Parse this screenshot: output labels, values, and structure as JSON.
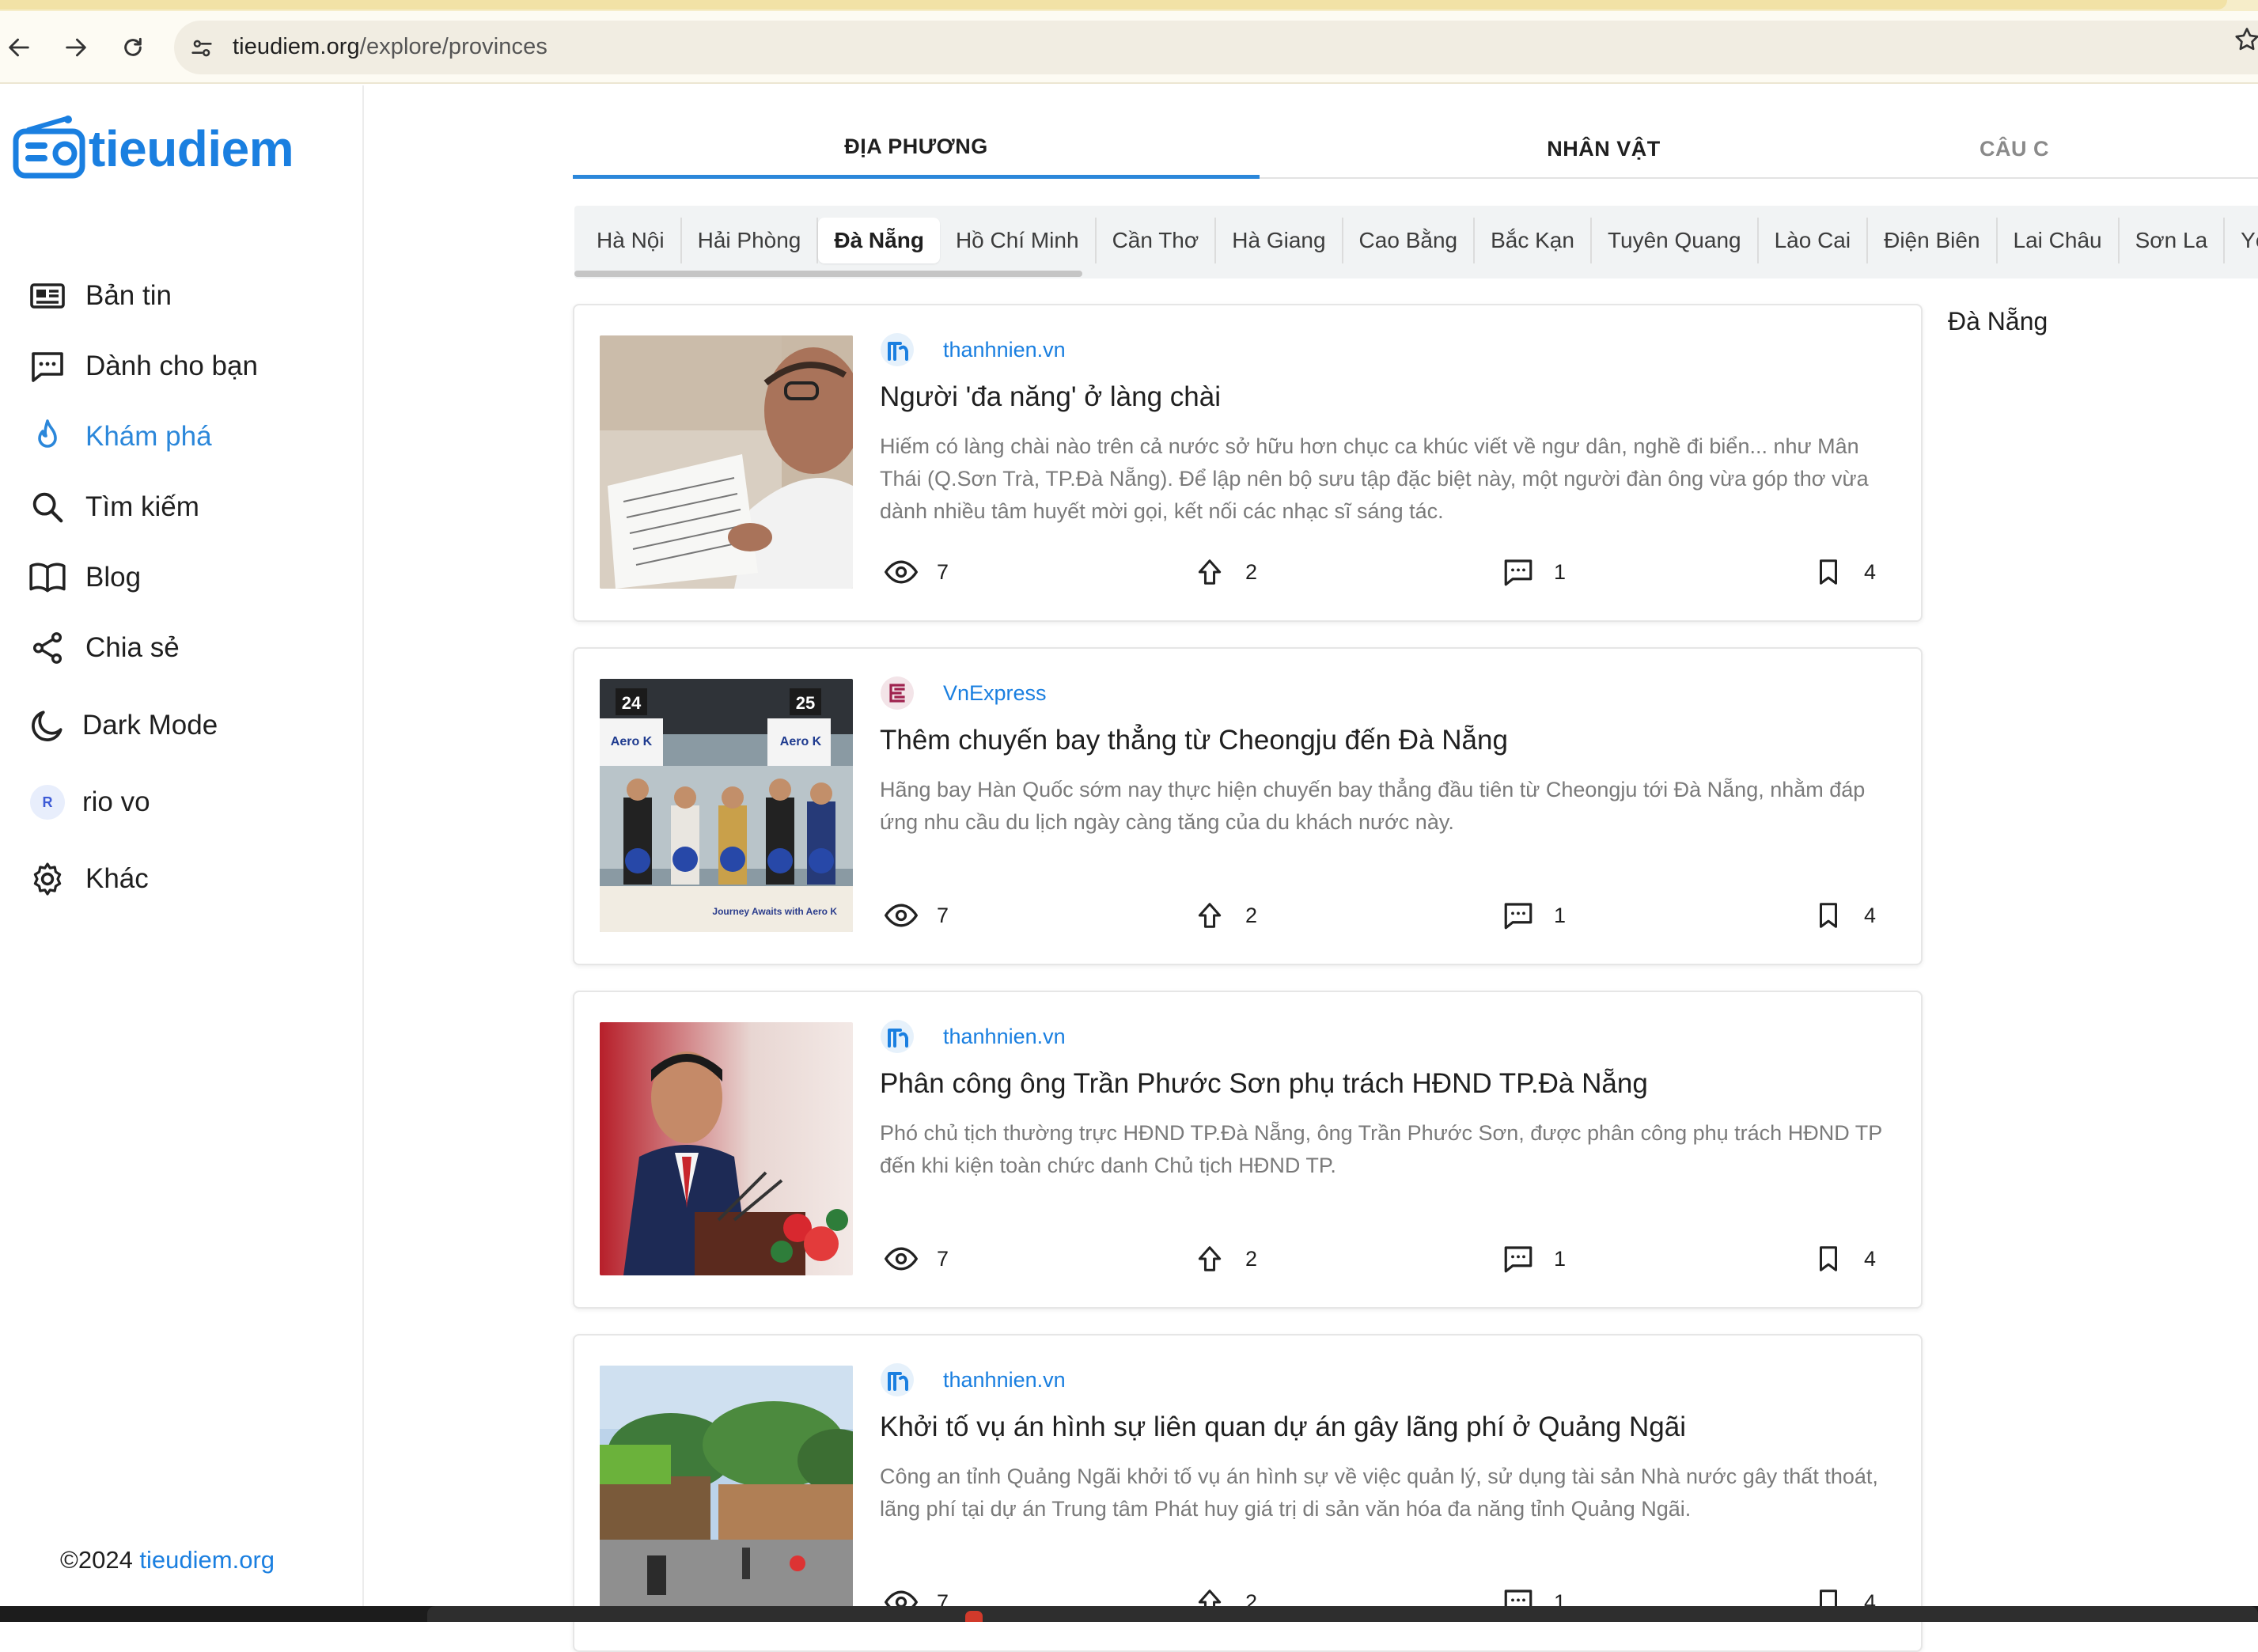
{
  "browser": {
    "url_host": "tieudiem.org",
    "url_path": "/explore/provinces"
  },
  "sidebar": {
    "logo_text": "tieudiem",
    "items": [
      {
        "label": "Bản tin",
        "icon": "newspaper-icon"
      },
      {
        "label": "Dành cho bạn",
        "icon": "chat-bubble-icon"
      },
      {
        "label": "Khám phá",
        "icon": "flame-icon",
        "active": true
      },
      {
        "label": "Tìm kiếm",
        "icon": "search-icon"
      },
      {
        "label": "Blog",
        "icon": "book-icon"
      },
      {
        "label": "Chia sẻ",
        "icon": "share-icon"
      },
      {
        "label": "Dark Mode",
        "icon": "moon-icon"
      },
      {
        "label": "rio vo",
        "icon": "avatar",
        "avatar_letter": "R"
      },
      {
        "label": "Khác",
        "icon": "gear-icon"
      }
    ],
    "footer_prefix": "©2024 ",
    "footer_link": "tieudiem.org"
  },
  "tabs": [
    {
      "label": "ĐỊA PHƯƠNG",
      "active": true
    },
    {
      "label": "NHÂN VẬT",
      "active": false
    },
    {
      "label": "CÂU C",
      "active": false
    }
  ],
  "provinces": [
    "Hà Nội",
    "Hải Phòng",
    "Đà Nẵng",
    "Hồ Chí Minh",
    "Cần Thơ",
    "Hà Giang",
    "Cao Bằng",
    "Bắc Kạn",
    "Tuyên Quang",
    "Lào Cai",
    "Điện Biên",
    "Lai Châu",
    "Sơn La",
    "Yên Bái"
  ],
  "active_province": "Đà Nẵng",
  "right_panel_label": "Đà Nẵng",
  "articles": [
    {
      "source": "thanhnien.vn",
      "source_icon": "thanhnien-logo",
      "title": "Người 'đa năng' ở làng chài",
      "summary": "Hiếm có làng chài nào trên cả nước sở hữu hơn chục ca khúc viết về ngư dân, nghề đi biển... như Mân Thái (Q.Sơn Trà, TP.Đà Nẵng). Để lập nên bộ sưu tập đặc biệt này, một người đàn ông vừa góp thơ vừa dành nhiều tâm huyết mời gọi, kết nối các nhạc sĩ sáng tác.",
      "views": "7",
      "upvotes": "2",
      "comments": "1",
      "bookmarks": "4"
    },
    {
      "source": "VnExpress",
      "source_icon": "vnexpress-logo",
      "title": "Thêm chuyến bay thẳng từ Cheongju đến Đà Nẵng",
      "summary": "Hãng bay Hàn Quốc sớm nay thực hiện chuyến bay thẳng đầu tiên từ Cheongju tới Đà Nẵng, nhằm đáp ứng nhu cầu du lịch ngày càng tăng của du khách nước này.",
      "views": "7",
      "upvotes": "2",
      "comments": "1",
      "bookmarks": "4",
      "thumb_text": {
        "gate_a": "24",
        "gate_b": "25",
        "brand_a": "Aero K",
        "brand_b": "Aero K",
        "banner": "Journey Awaits with Aero K"
      }
    },
    {
      "source": "thanhnien.vn",
      "source_icon": "thanhnien-logo",
      "title": "Phân công ông Trần Phước Sơn phụ trách HĐND TP.Đà Nẵng",
      "summary": "Phó chủ tịch thường trực HĐND TP.Đà Nẵng, ông Trần Phước Sơn, được phân công phụ trách HĐND TP đến khi kiện toàn chức danh Chủ tịch HĐND TP.",
      "views": "7",
      "upvotes": "2",
      "comments": "1",
      "bookmarks": "4"
    },
    {
      "source": "thanhnien.vn",
      "source_icon": "thanhnien-logo",
      "title": "Khởi tố vụ án hình sự liên quan dự án gây lãng phí ở Quảng Ngãi",
      "summary": "Công an tỉnh Quảng Ngãi khởi tố vụ án hình sự về việc quản lý, sử dụng tài sản Nhà nước gây thất thoát, lãng phí tại dự án Trung tâm Phát huy giá trị di sản văn hóa đa năng tỉnh Quảng Ngãi.",
      "views": "7",
      "upvotes": "2",
      "comments": "1",
      "bookmarks": "4"
    }
  ],
  "colors": {
    "brand": "#1a7fe0",
    "active_tab": "#2b87da",
    "summary_text": "#7a7a7a"
  }
}
